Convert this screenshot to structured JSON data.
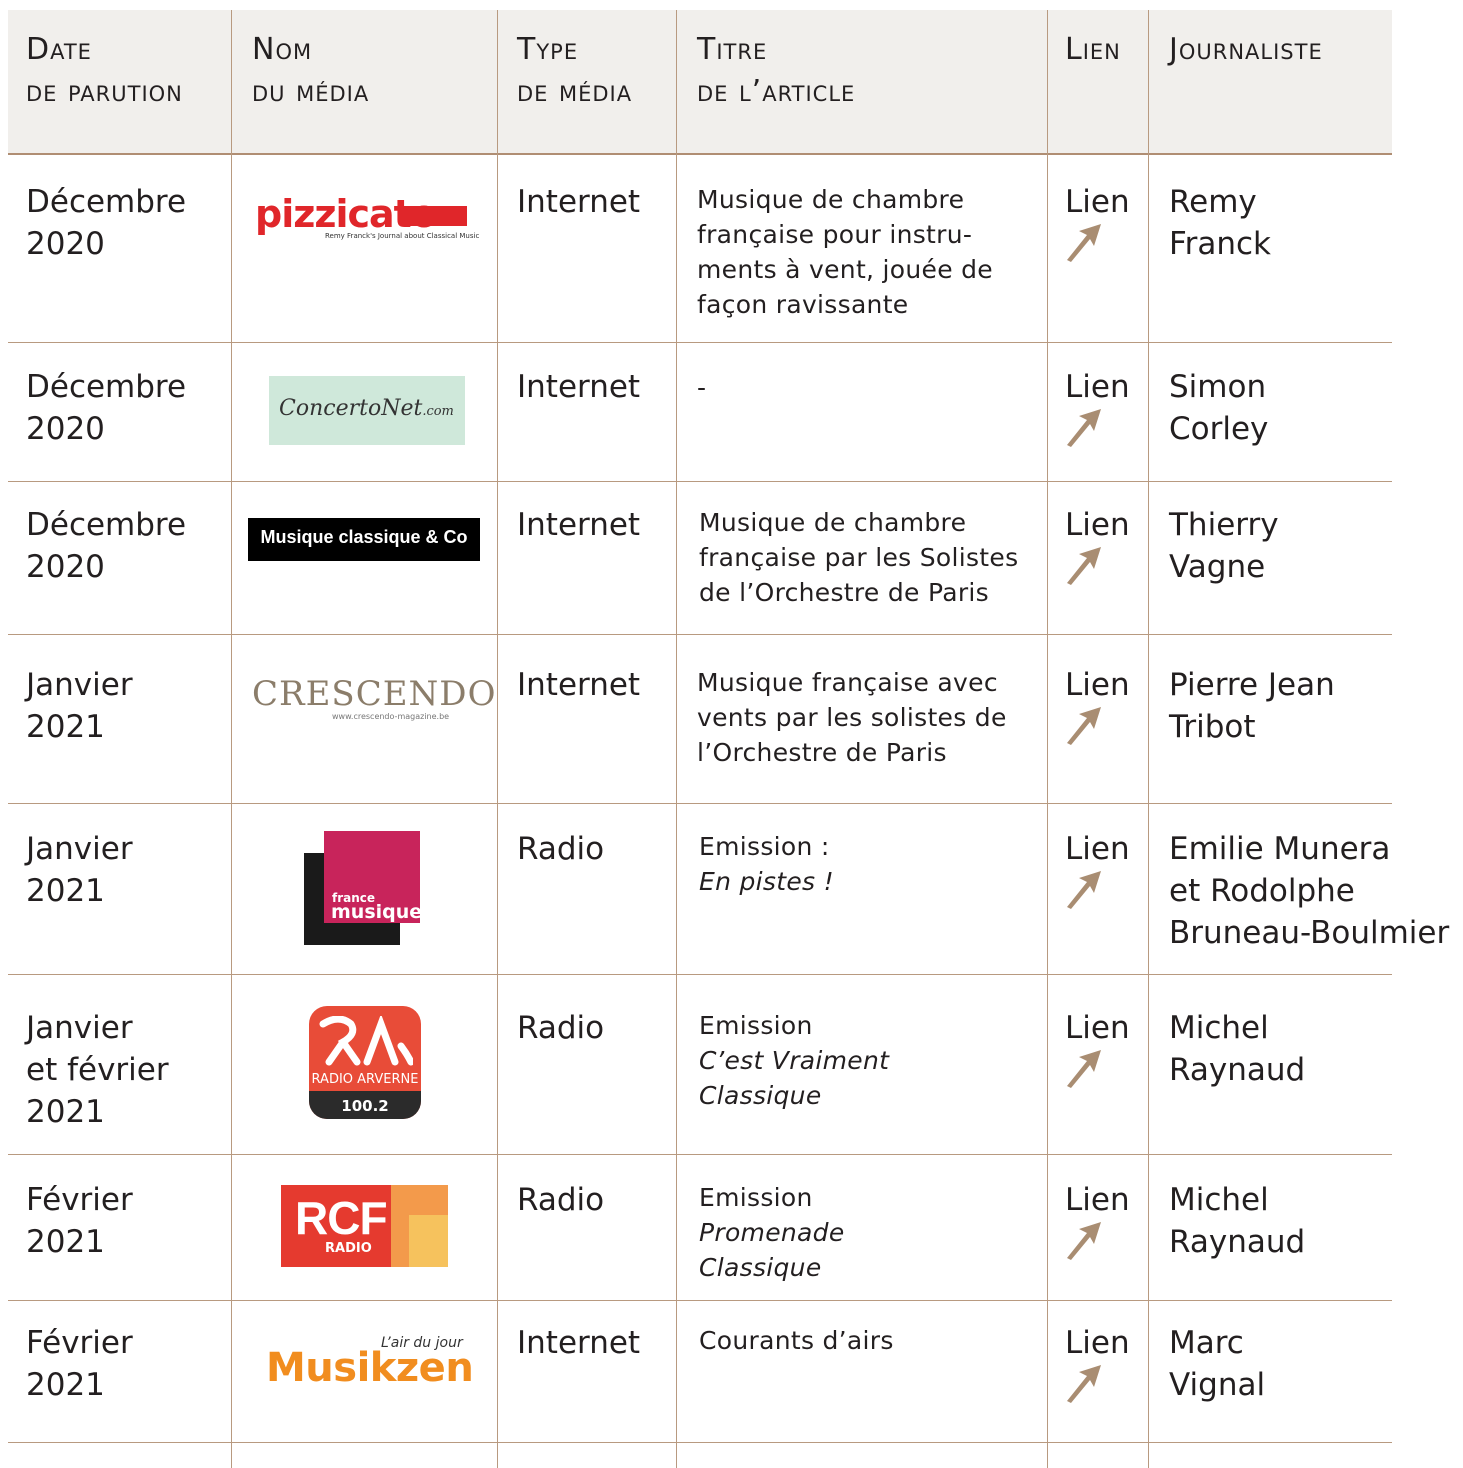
{
  "columns": [
    {
      "first": "Date",
      "second": "de parution"
    },
    {
      "first": "Nom",
      "second": "du média"
    },
    {
      "first": "Type",
      "second": "de média"
    },
    {
      "first": "Titre",
      "second": "de l’article"
    },
    {
      "first": "Lien",
      "second": ""
    },
    {
      "first": "Journaliste",
      "second": ""
    }
  ],
  "link_label": "Lien",
  "colors": {
    "accent": "#a98d72",
    "header_bg": "#f1efec",
    "rule": "#b89a80"
  },
  "rows": [
    {
      "date": [
        "Décembre",
        "2020"
      ],
      "media_logo": "pizzicato-logo",
      "logo_text": {
        "main": "pizzicato",
        "sub": "Remy Franck's Journal about Classical Music"
      },
      "type": "Internet",
      "title": [
        "Musique de chambre",
        "française pour instru-",
        "ments à vent, jouée de",
        "façon ravissante"
      ],
      "journalist": [
        "Remy",
        "Franck"
      ]
    },
    {
      "date": [
        "Décembre",
        "2020"
      ],
      "media_logo": "concertonet-logo",
      "logo_text": {
        "main": "ConcertoNet",
        "sub": ".com"
      },
      "type": "Internet",
      "title": [
        "-"
      ],
      "journalist": [
        "Simon",
        "Corley"
      ]
    },
    {
      "date": [
        "Décembre",
        "2020"
      ],
      "media_logo": "musique-classique-co-logo",
      "logo_text": {
        "main": "Musique classique & Co"
      },
      "type": "Internet",
      "title": [
        "Musique de chambre",
        "française par les Solistes",
        "de l’Orchestre de Paris"
      ],
      "journalist": [
        "Thierry",
        "Vagne"
      ]
    },
    {
      "date": [
        "Janvier",
        "2021"
      ],
      "media_logo": "crescendo-logo",
      "logo_text": {
        "main": "CRESCENDO",
        "sub": "www.crescendo-magazine.be"
      },
      "type": "Internet",
      "title": [
        "Musique française avec",
        "vents par les solistes de",
        "l’Orchestre de Paris"
      ],
      "journalist": [
        "Pierre Jean",
        "Tribot"
      ]
    },
    {
      "date": [
        "Janvier",
        "2021"
      ],
      "media_logo": "france-musique-logo",
      "logo_text": {
        "main": "musique",
        "sub": "france"
      },
      "type": "Radio",
      "title_plain": "Emission :",
      "title_italic": [
        "En pistes !"
      ],
      "journalist": [
        "Emilie Munera",
        "et Rodolphe",
        "Bruneau-Boulmier"
      ]
    },
    {
      "date": [
        "Janvier",
        "et février",
        "2021"
      ],
      "media_logo": "radio-arverne-logo",
      "logo_text": {
        "main": "RADIO ARVERNE",
        "sub": "100.2"
      },
      "type": "Radio",
      "title_plain": "Emission",
      "title_italic": [
        "C’est Vraiment",
        "Classique"
      ],
      "journalist": [
        "Michel",
        "Raynaud"
      ]
    },
    {
      "date": [
        "Février",
        "2021"
      ],
      "media_logo": "rcf-radio-logo",
      "logo_text": {
        "main": "RCF",
        "sub": "RADIO"
      },
      "type": "Radio",
      "title_plain": "Emission",
      "title_italic": [
        "Promenade",
        "Classique"
      ],
      "journalist": [
        "Michel",
        "Raynaud"
      ]
    },
    {
      "date": [
        "Février",
        "2021"
      ],
      "media_logo": "musikzen-logo",
      "logo_text": {
        "main": "Musikzen",
        "sub": "L’air du jour"
      },
      "type": "Internet",
      "title": [
        "Courants d’airs"
      ],
      "journalist": [
        "Marc",
        "Vignal"
      ]
    }
  ]
}
